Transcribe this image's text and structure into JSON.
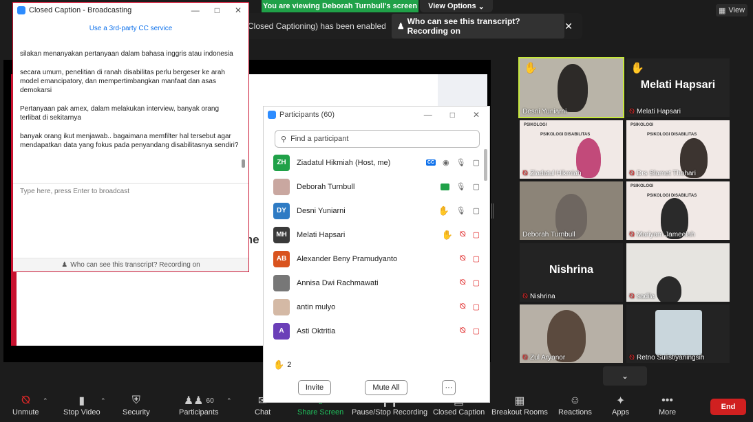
{
  "banners": {
    "viewing": "You are viewing Deborah Turnbull's screen",
    "view_options": "View Options",
    "view": "View",
    "cc_message": "Closed Captioning) has been enabled",
    "cc_who": "Who can see this transcript? Recording on"
  },
  "shared_slide": {
    "text": "me pa"
  },
  "cc_window": {
    "title": "Closed Caption - Broadcasting",
    "third_party": "Use a 3rd-party CC service",
    "lines": [
      "silakan menanyakan pertanyaan dalam bahasa inggris atau indonesia",
      "secara umum, penelitian di ranah disabilitas perlu bergeser ke arah model emancipatory, dan mempertimbangkan manfaat dan asas demokarsi",
      "Pertanyaan pak amex, dalam melakukan interview, banyak orang terlibat di sekitarnya",
      "banyak orang ikut menjawab.. bagaimana memfilter hal tersebut agar mendapatkan data yang fokus pada penyandang disabilitasnya sendiri?"
    ],
    "placeholder": "Type here, press Enter to broadcast",
    "footer": "Who can see this transcript? Recording on"
  },
  "participants_window": {
    "title": "Participants (60)",
    "search_placeholder": "Find a participant",
    "raised_count": "2",
    "invite": "Invite",
    "mute_all": "Mute All",
    "more": "···",
    "rows": [
      {
        "initials": "ZH",
        "name": "Ziadatul Hikmiah (Host, me)",
        "color": "#20a148"
      },
      {
        "initials": "",
        "name": "Deborah Turnbull",
        "color": "#c9a7a0"
      },
      {
        "initials": "DY",
        "name": "Desni Yuniarni",
        "color": "#2e7bc4"
      },
      {
        "initials": "MH",
        "name": "Melati Hapsari",
        "color": "#3a3a3a"
      },
      {
        "initials": "AB",
        "name": "Alexander Beny Pramudyanto",
        "color": "#d9531e"
      },
      {
        "initials": "",
        "name": "Annisa Dwi Rachmawati",
        "color": "#777"
      },
      {
        "initials": "",
        "name": "antin mulyo",
        "color": "#d4b9a5"
      },
      {
        "initials": "A",
        "name": "Asti Oktritia",
        "color": "#6b3fb8"
      }
    ]
  },
  "gallery": [
    {
      "name": "Desni Yuniarni"
    },
    {
      "name": "Melati Hapsari",
      "big": "Melati Hapsari"
    },
    {
      "name": "Ziadatul Hikmiah",
      "slide_tag": "PSIKOLOGI",
      "slide_title": "PSIKOLOGI DISABILITAS"
    },
    {
      "name": "Drs Slamet Thohari",
      "slide_tag": "PSIKOLOGI",
      "slide_title": "PSIKOLOGI DISABILITAS"
    },
    {
      "name": "Deborah Turnbull"
    },
    {
      "name": "Mariyam Jameelah",
      "slide_tag": "PSIKOLOGI",
      "slide_title": "PSIKOLOGI DISABILITAS"
    },
    {
      "name": "Nishrina",
      "big": "Nishrina"
    },
    {
      "name": "sadila"
    },
    {
      "name": "Zul Aryanor"
    },
    {
      "name": "Retno Sulistiyaningsih"
    }
  ],
  "toolbar": {
    "unmute": "Unmute",
    "stop_video": "Stop Video",
    "security": "Security",
    "participants": "Participants",
    "participants_count": "60",
    "chat": "Chat",
    "share_screen": "Share Screen",
    "recording": "Pause/Stop Recording",
    "closed_caption": "Closed Caption",
    "breakout": "Breakout Rooms",
    "reactions": "Reactions",
    "apps": "Apps",
    "more": "More",
    "end": "End"
  }
}
